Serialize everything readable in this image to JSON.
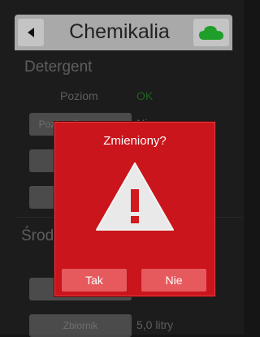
{
  "header": {
    "title": "Chemikalia",
    "back_icon": "back-arrow-icon",
    "cloud_icon": "cloud-icon",
    "cloud_color": "#1f9e2a"
  },
  "sections": {
    "detergent": {
      "title": "Detergent",
      "level_label": "Poziom",
      "level_value": "OK",
      "level_button": "Poziom Detergentu",
      "level_button_suffix": "Nie"
    },
    "second": {
      "title": "Środ",
      "level_button": "Poziom",
      "tank_button": "Zbiornik",
      "tank_value": "5,0 litry"
    }
  },
  "dialog": {
    "title": "Zmieniony?",
    "icon": "warning-triangle-icon",
    "accent": "#c9151b",
    "yes_label": "Tak",
    "no_label": "Nie"
  }
}
